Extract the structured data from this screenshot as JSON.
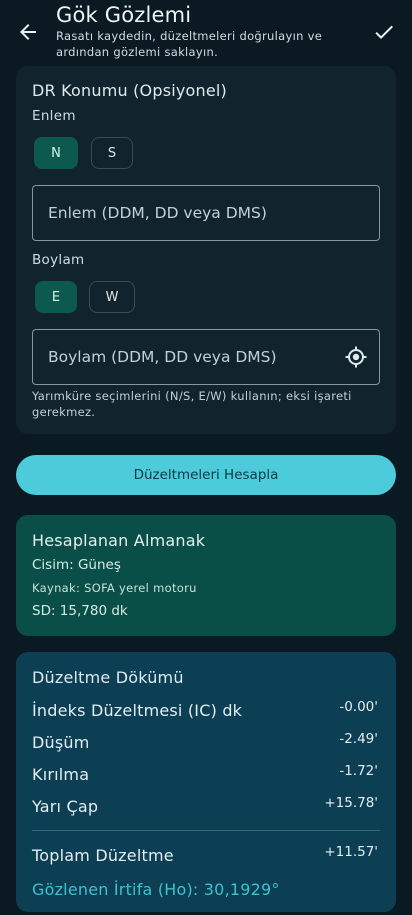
{
  "appbar": {
    "title": "Gök Gözlemi",
    "subtitle": "Rasatı kaydedin, düzeltmeleri doğrulayın ve ardından gözlemi saklayın."
  },
  "icons": {
    "back": "arrow-back-icon",
    "confirm": "check-icon",
    "location": "gps-fixed-icon"
  },
  "dr": {
    "title": "DR Konumu (Opsiyonel)",
    "lat_label": "Enlem",
    "lat_options": [
      "N",
      "S"
    ],
    "lat_selected": "N",
    "lat_placeholder": "Enlem (DDM, DD veya DMS)",
    "lon_label": "Boylam",
    "lon_options": [
      "E",
      "W"
    ],
    "lon_selected": "E",
    "lon_placeholder": "Boylam (DDM, DD veya DMS)",
    "helper": "Yarımküre seçimlerini (N/S, E/W) kullanın; eksi işareti gerekmez."
  },
  "compute_label": "Düzeltmeleri Hesapla",
  "almanac": {
    "title": "Hesaplanan Almanak",
    "body": "Cisim: Güneş",
    "source": "Kaynak: SOFA yerel motoru",
    "sd": "SD: 15,780 dk"
  },
  "breakdown": {
    "title": "Düzeltme Dökümü",
    "rows": [
      {
        "label": "İndeks Düzeltmesi (IC) dk",
        "value": "-0.00'"
      },
      {
        "label": "Düşüm",
        "value": "-2.49'"
      },
      {
        "label": "Kırılma",
        "value": "-1.72'"
      },
      {
        "label": "Yarı Çap",
        "value": "+15.78'"
      }
    ],
    "total_label": "Toplam Düzeltme",
    "total_value": "+11.57'",
    "observed": "Gözlenen İrtifa (Ho): 30,1929°"
  },
  "colors": {
    "background": "#0b1a22",
    "accent": "#4ccbdb",
    "selected_chip": "#0c5a4e",
    "almanac_card": "#0a4f47",
    "breakdown_card": "#0c3e54"
  }
}
